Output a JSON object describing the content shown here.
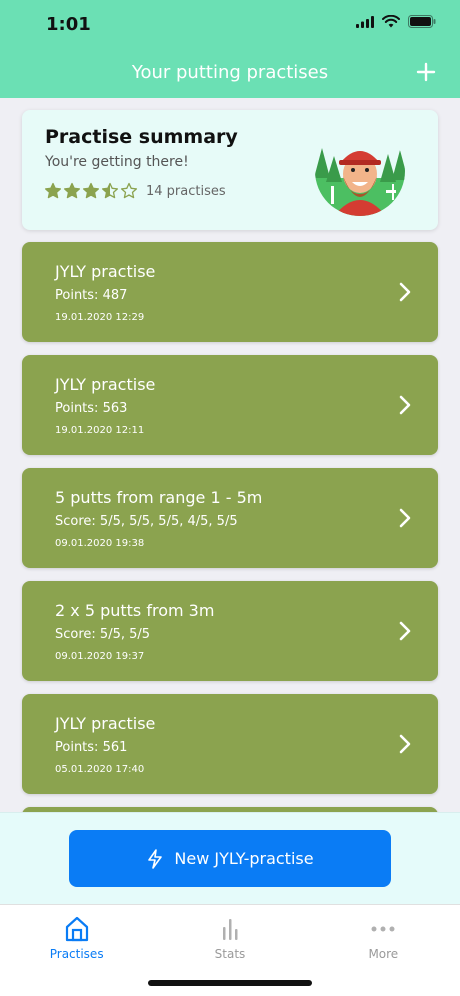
{
  "status": {
    "time": "1:01"
  },
  "header": {
    "title": "Your putting practises"
  },
  "summary": {
    "title": "Practise summary",
    "subtitle": "You're getting there!",
    "rating": 3.5,
    "rating_max": 5,
    "count_label": "14 practises"
  },
  "practices": [
    {
      "title": "JYLY practise",
      "score": "Points: 487",
      "date": "19.01.2020 12:29"
    },
    {
      "title": "JYLY practise",
      "score": "Points: 563",
      "date": "19.01.2020 12:11"
    },
    {
      "title": "5 putts from range 1 - 5m",
      "score": "Score: 5/5, 5/5, 5/5, 4/5, 5/5",
      "date": "09.01.2020 19:38"
    },
    {
      "title": "2 x 5 putts from 3m",
      "score": "Score: 5/5, 5/5",
      "date": "09.01.2020 19:37"
    },
    {
      "title": "JYLY practise",
      "score": "Points: 561",
      "date": "05.01.2020 17:40"
    }
  ],
  "action": {
    "new_practice_label": "New JYLY-practise"
  },
  "tabs": [
    {
      "label": "Practises",
      "icon": "home-icon",
      "active": true
    },
    {
      "label": "Stats",
      "icon": "bar-chart-icon",
      "active": false
    },
    {
      "label": "More",
      "icon": "more-dots-icon",
      "active": false
    }
  ],
  "colors": {
    "header": "#6be0b4",
    "card": "#8ba34f",
    "accent": "#0a7cf5",
    "star": "#8ba34f"
  }
}
